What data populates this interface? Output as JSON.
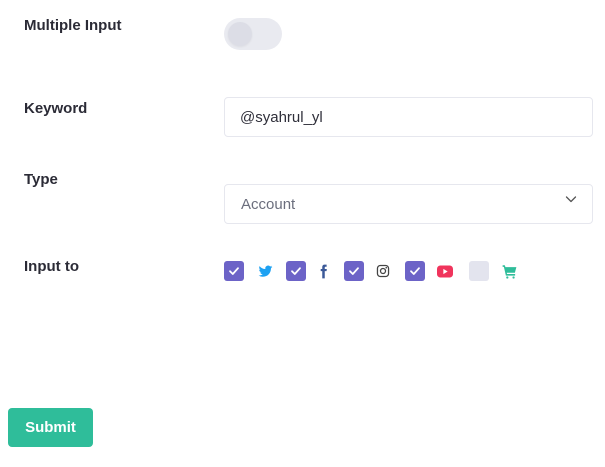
{
  "form": {
    "multiple_input": {
      "label": "Multiple Input",
      "enabled": false
    },
    "keyword": {
      "label": "Keyword",
      "value": "@syahrul_yl"
    },
    "type": {
      "label": "Type",
      "selected": "Account"
    },
    "input_to": {
      "label": "Input to",
      "platforms": [
        {
          "icon": "twitter-icon",
          "checked": true,
          "color": "#1da1f2"
        },
        {
          "icon": "facebook-icon",
          "checked": true,
          "color": "#3b5998"
        },
        {
          "icon": "instagram-icon",
          "checked": true,
          "color": "#444444"
        },
        {
          "icon": "youtube-icon",
          "checked": true,
          "color": "#f0345c"
        },
        {
          "icon": "cart-icon",
          "checked": false,
          "color": "#2fbd9a"
        }
      ]
    },
    "submit_label": "Submit"
  },
  "colors": {
    "checkbox_checked": "#6c63c7",
    "checkbox_unchecked": "#e3e4ee",
    "submit": "#2fbd9a"
  }
}
